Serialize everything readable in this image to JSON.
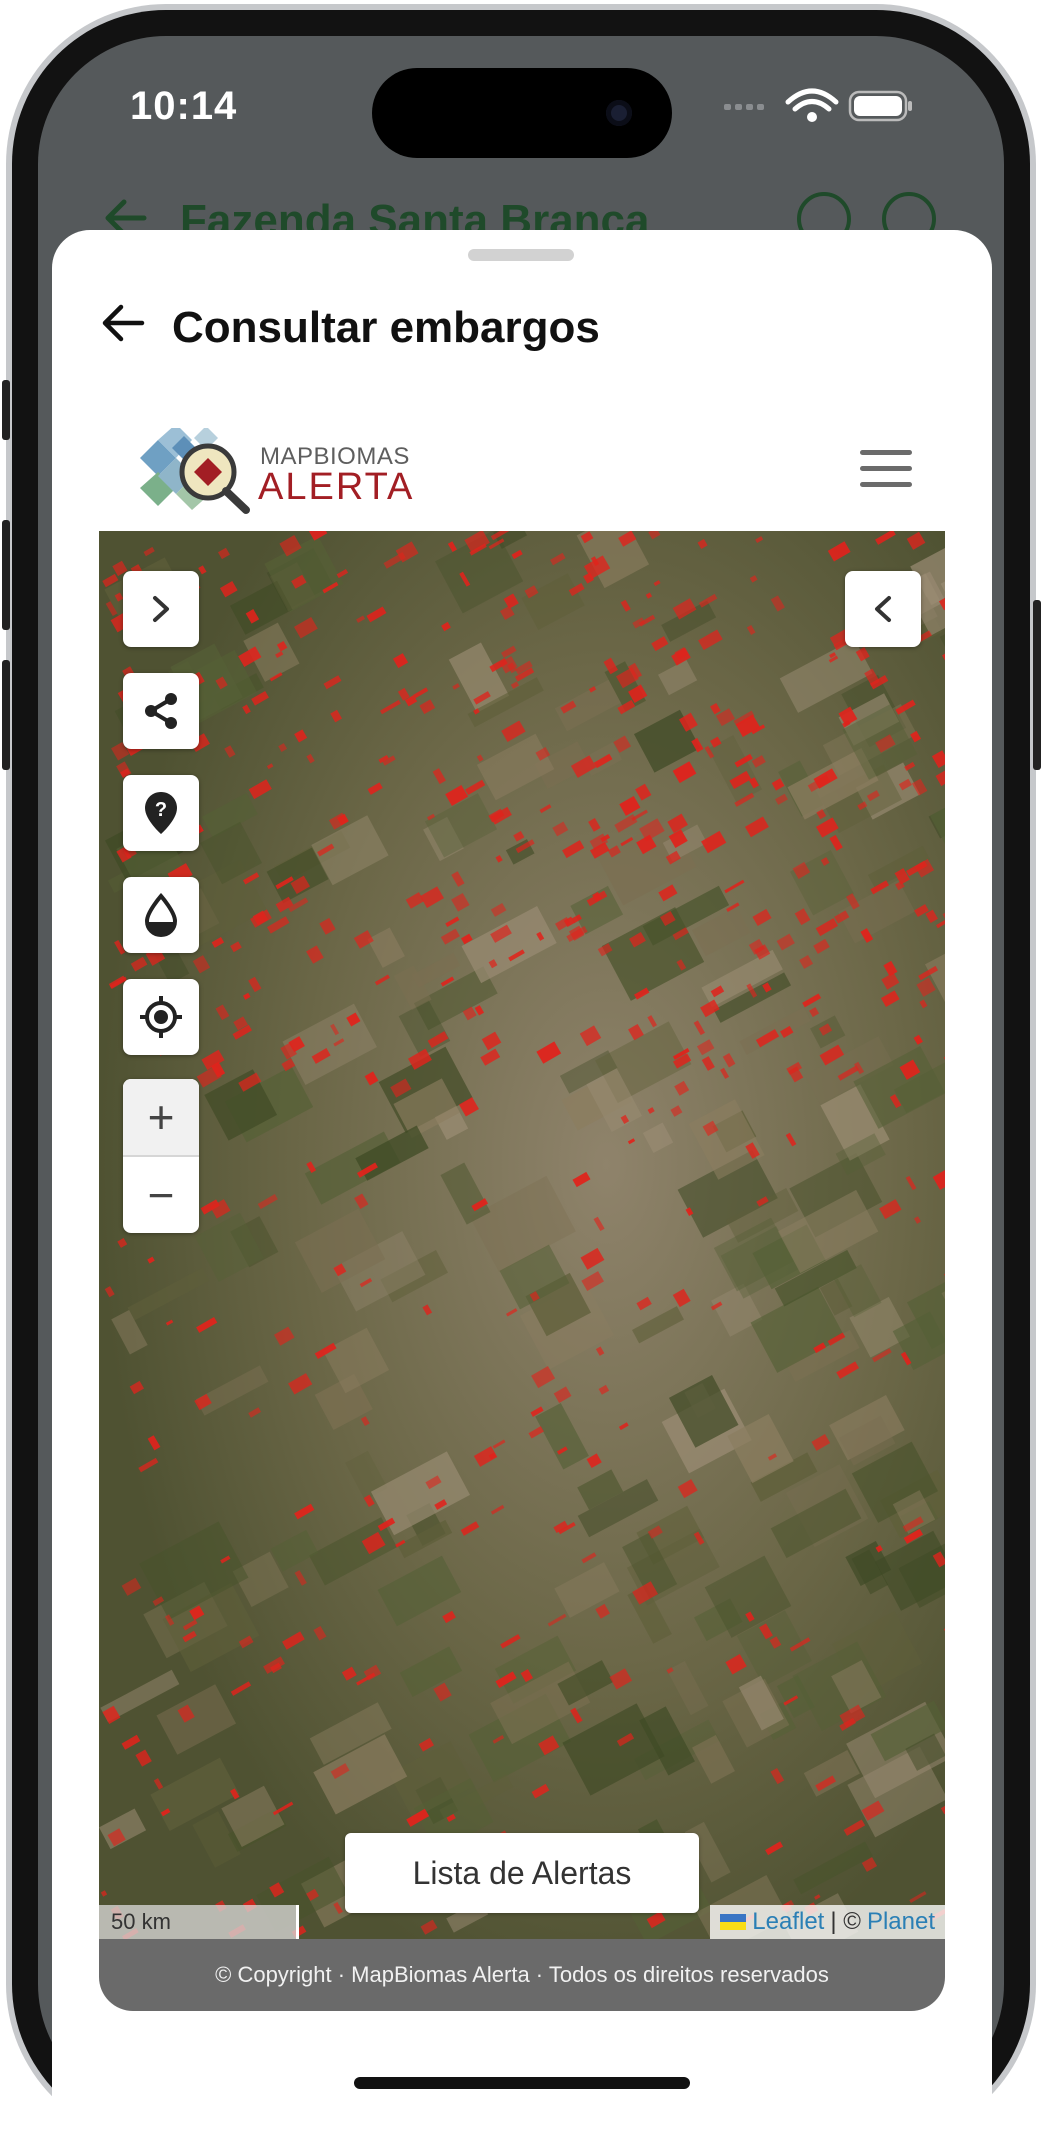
{
  "status_bar": {
    "time": "10:14"
  },
  "background_screen": {
    "title": "Fazenda Santa Branca"
  },
  "sheet": {
    "title": "Consultar embargos"
  },
  "brand": {
    "line1": "MAPBIOMAS",
    "line2": "ALERTA",
    "accent_color": "#a21e24"
  },
  "map": {
    "controls": [
      "expand-panel",
      "share",
      "help",
      "opacity",
      "locate",
      "zoom-in",
      "zoom-out",
      "collapse-panel"
    ],
    "zoom_in_label": "+",
    "zoom_out_label": "−",
    "scale_label": "50 km",
    "attribution": {
      "leaflet": "Leaflet",
      "separator": "| ©",
      "provider": "Planet"
    },
    "alerts_button_label": "Lista de Alertas"
  },
  "footer": {
    "text": "© Copyright · MapBiomas Alerta · Todos os direitos reservados"
  }
}
